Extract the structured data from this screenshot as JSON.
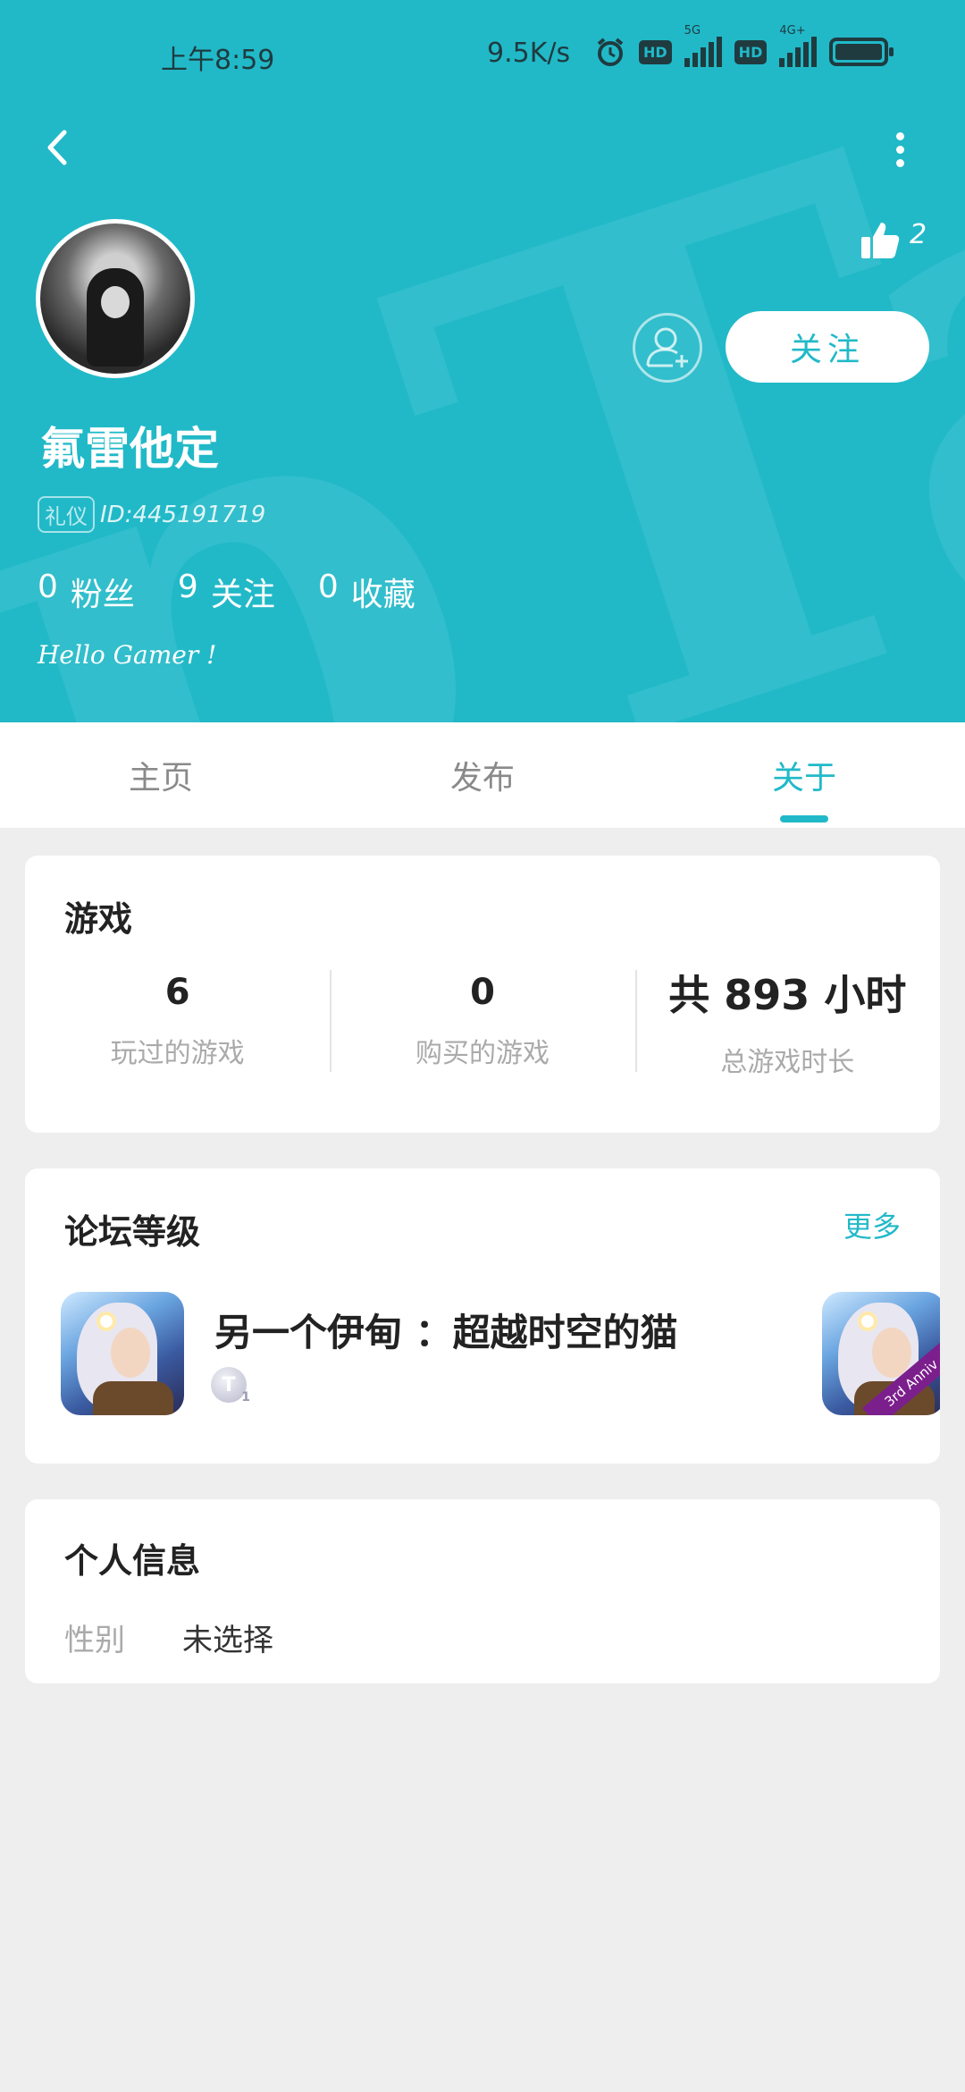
{
  "status_bar": {
    "time": "上午8:59",
    "net_speed": "9.5K/s",
    "hd1": "HD",
    "net1": "5G",
    "hd2": "HD",
    "net2": "4G+"
  },
  "profile": {
    "likes_count": "2",
    "username": "氟雷他定",
    "badge": "礼仪",
    "id_text": "ID:445191719",
    "followers_count": "0",
    "followers_label": "粉丝",
    "following_count": "9",
    "following_label": "关注",
    "favorites_count": "0",
    "favorites_label": "收藏",
    "bio": "Hello Gamer !",
    "follow_button": "关注"
  },
  "tabs": [
    {
      "label": "主页",
      "active": false
    },
    {
      "label": "发布",
      "active": false
    },
    {
      "label": "关于",
      "active": true
    }
  ],
  "games": {
    "title": "游戏",
    "played_count": "6",
    "played_label": "玩过的游戏",
    "purchased_count": "0",
    "purchased_label": "购买的游戏",
    "playtime": "共 893 小时",
    "playtime_label": "总游戏时长"
  },
  "forum_level": {
    "title": "论坛等级",
    "more": "更多",
    "game_name": "另一个伊甸 ：超越时空的猫",
    "level_letter": "T",
    "level_number": "1",
    "icon_ribbon": "3rd Anniv"
  },
  "personal_info": {
    "title": "个人信息",
    "gender_label": "性别",
    "gender_value": "未选择"
  },
  "icons": {
    "back": "chevron-left-icon",
    "more": "more-vertical-icon",
    "like": "thumbs-up-icon",
    "add_friend": "user-plus-icon",
    "alarm": "alarm-icon"
  },
  "colors": {
    "accent": "#21b9c8",
    "background": "#eeeeee"
  }
}
